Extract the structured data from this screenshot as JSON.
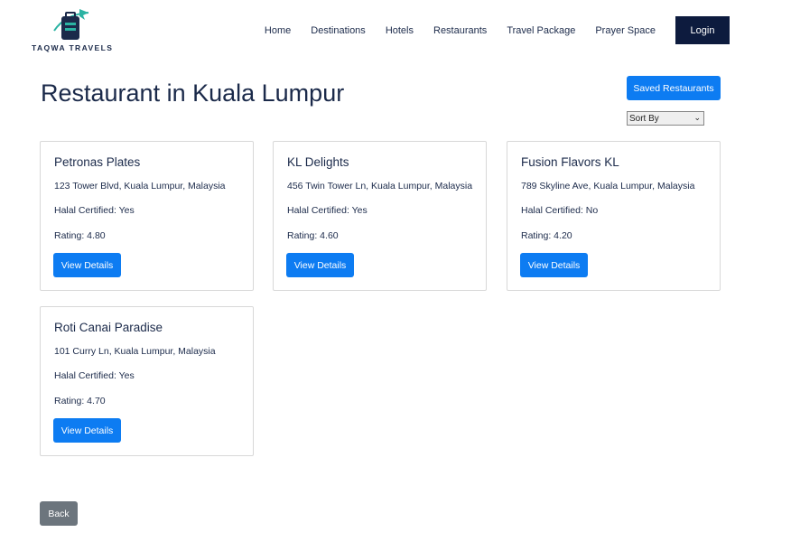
{
  "brand": {
    "name": "TAQWA TRAVELS"
  },
  "nav": {
    "items": [
      "Home",
      "Destinations",
      "Hotels",
      "Restaurants",
      "Travel Package",
      "Prayer Space"
    ],
    "login_label": "Login"
  },
  "page": {
    "title": "Restaurant in Kuala Lumpur",
    "saved_label": "Saved Restaurants",
    "sort_label": "Sort By",
    "back_label": "Back"
  },
  "restaurants": [
    {
      "name": "Petronas Plates",
      "address": "123 Tower Blvd, Kuala Lumpur, Malaysia",
      "halal": "Halal Certified: Yes",
      "rating": "Rating: 4.80",
      "button": "View Details"
    },
    {
      "name": "KL Delights",
      "address": "456 Twin Tower Ln, Kuala Lumpur, Malaysia",
      "halal": "Halal Certified: Yes",
      "rating": "Rating: 4.60",
      "button": "View Details"
    },
    {
      "name": "Fusion Flavors KL",
      "address": "789 Skyline Ave, Kuala Lumpur, Malaysia",
      "halal": "Halal Certified: No",
      "rating": "Rating: 4.20",
      "button": "View Details"
    },
    {
      "name": "Roti Canai Paradise",
      "address": "101 Curry Ln, Kuala Lumpur, Malaysia",
      "halal": "Halal Certified: Yes",
      "rating": "Rating: 4.70",
      "button": "View Details"
    }
  ],
  "colors": {
    "primary": "#0d7cf2",
    "navy": "#0d1b3e",
    "secondary": "#6c757d",
    "text": "#1b2a4a"
  }
}
